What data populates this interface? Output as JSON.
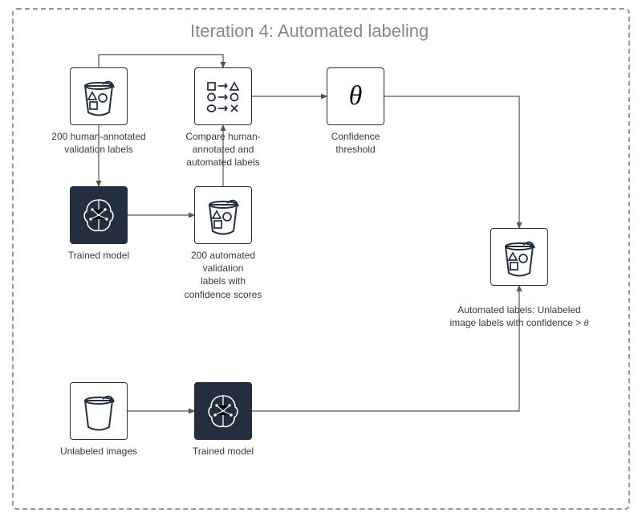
{
  "title": "Iteration 4: Automated labeling",
  "nodes": {
    "human_labels": {
      "label": "200 human-annotated\nvalidation labels"
    },
    "compare": {
      "label": "Compare human-\nannotated and\nautomated labels"
    },
    "threshold": {
      "label": "Confidence\nthreshold",
      "symbol": "θ"
    },
    "trained_model_1": {
      "label": "Trained model"
    },
    "auto_val_labels": {
      "label": "200 automated\nvalidation\nlabels with\nconfidence scores"
    },
    "auto_labels_out": {
      "label": "Automated labels: Unlabeled\nimage labels with confidence > θ"
    },
    "unlabeled": {
      "label": "Unlabeled images"
    },
    "trained_model_2": {
      "label": "Trained model"
    }
  }
}
